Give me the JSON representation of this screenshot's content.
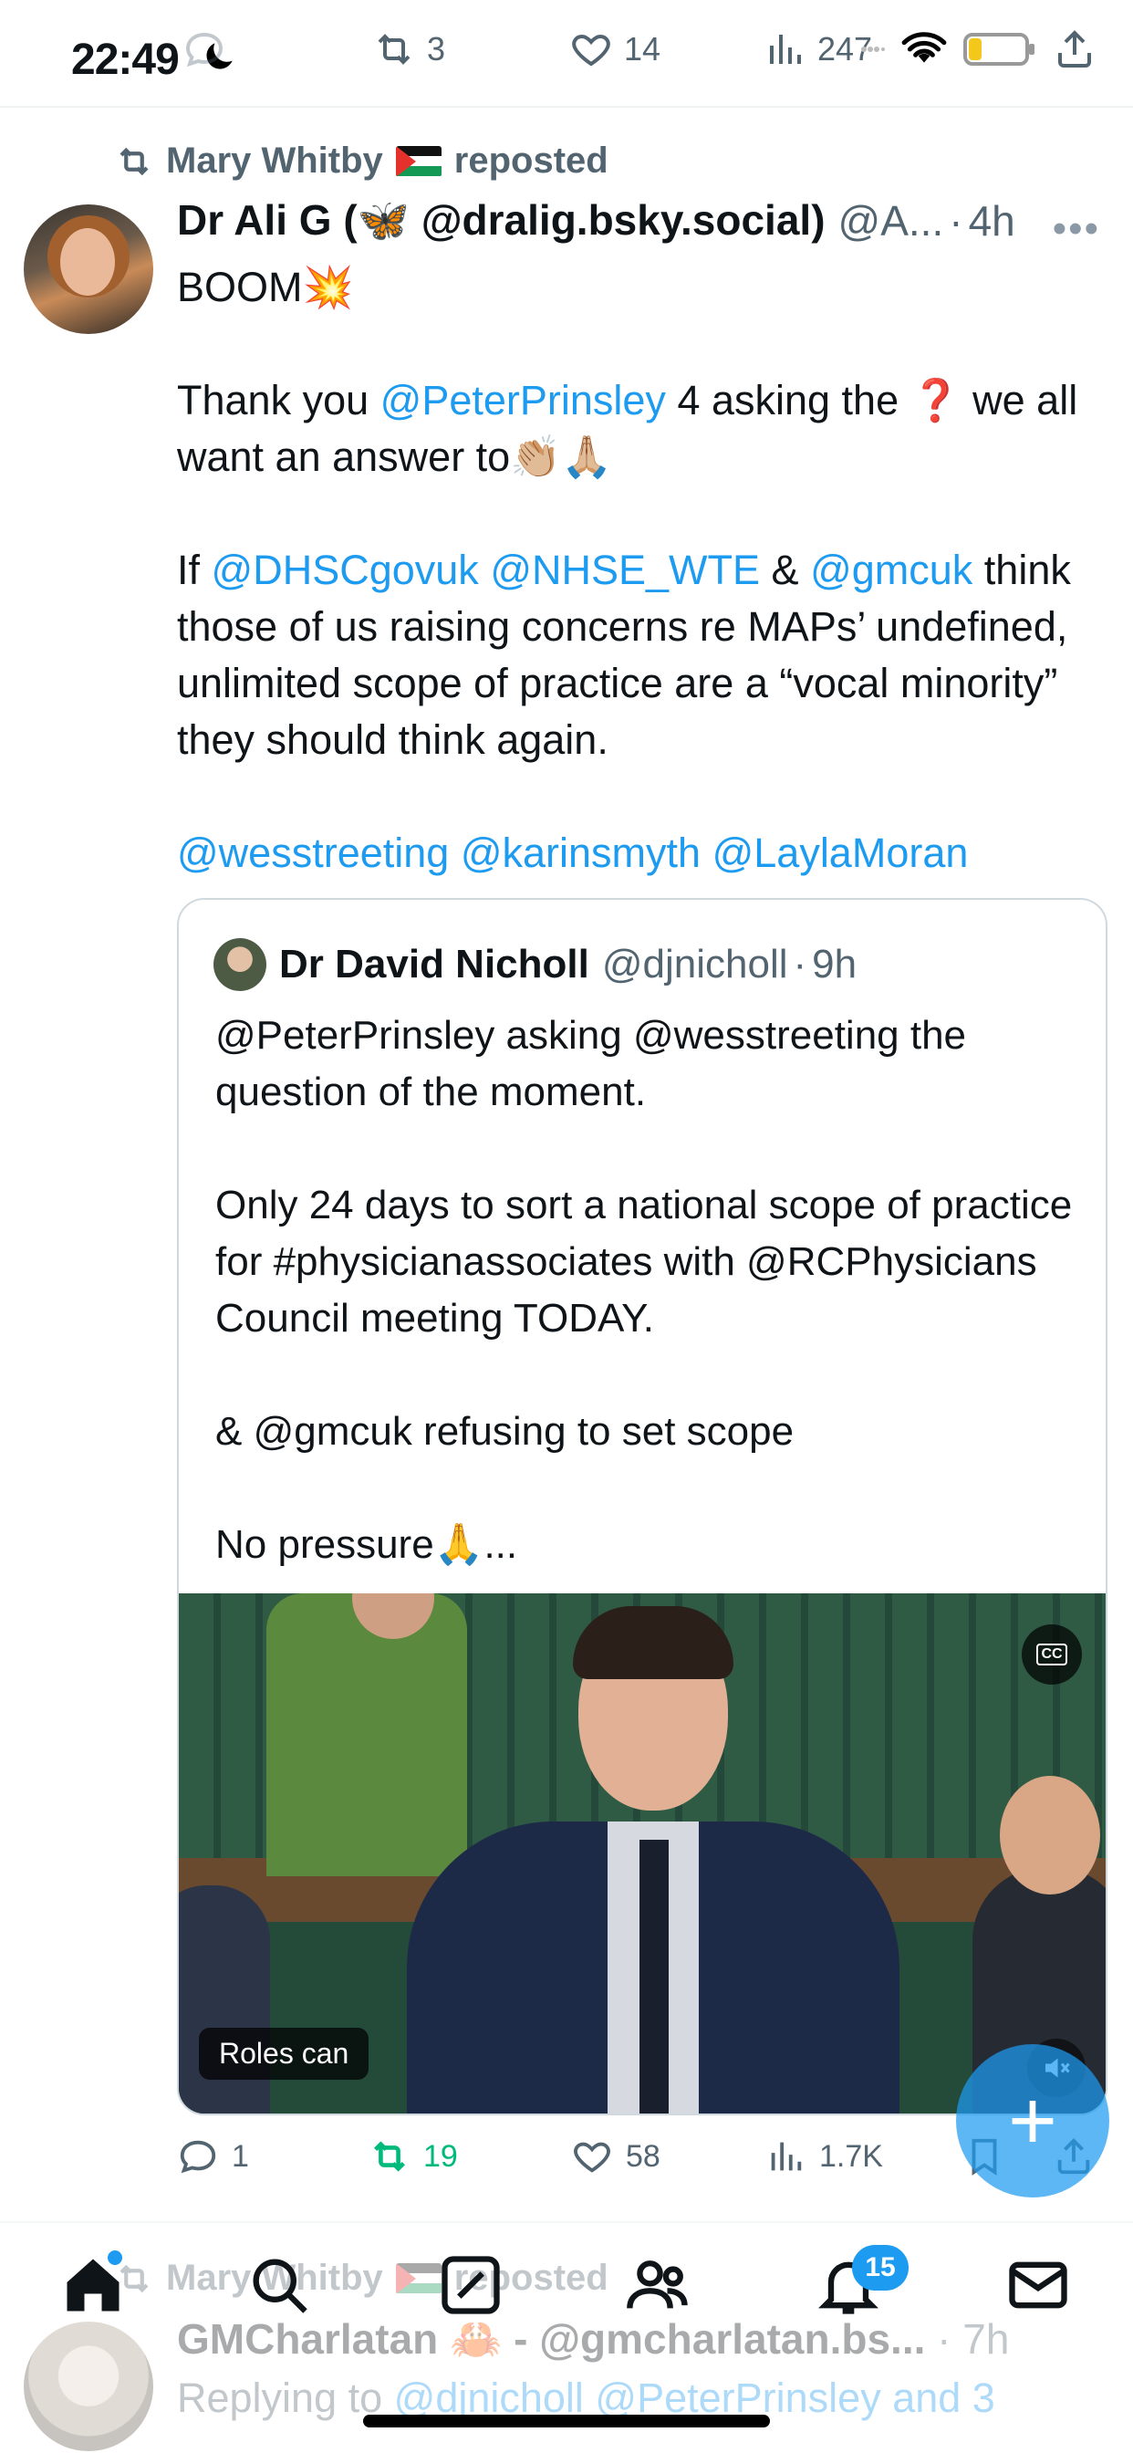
{
  "status_bar": {
    "time": "22:49",
    "reposts_count": "3",
    "likes_count": "14",
    "views_count": "247"
  },
  "tweet": {
    "reposted_by_name": "Mary Whitby",
    "reposted_label": "reposted",
    "author_name": "Dr Ali G (🦋 @dralig.bsky.social)",
    "author_handle": "@A...",
    "separator": "·",
    "timestamp": "4h",
    "line_boom": "BOOM💥",
    "p1_pre": "Thank you ",
    "p1_mention": "@PeterPrinsley",
    "p1_post": " 4 asking the ❓ we all want an answer to👏🏼🙏🏼",
    "p2_pre": "If ",
    "p2_m1": "@DHSCgovuk",
    "p2_m2": "@NHSE_WTE",
    "p2_amp": " & ",
    "p2_m3": "@gmcuk",
    "p2_post": " think those of us raising concerns re MAPs’ undefined, unlimited scope of practice are a “vocal minority” they should think again.",
    "p3_m1": "@wesstreeting",
    "p3_m2": "@karinsmyth",
    "p3_m3": "@LaylaMoran"
  },
  "quote": {
    "author_name": "Dr David Nicholl",
    "author_handle": "@djnicholl",
    "separator": "·",
    "timestamp": "9h",
    "p1": "@PeterPrinsley asking @wesstreeting the question of the moment.",
    "p2": "Only 24 days to sort a national scope of practice for #physicianassociates with @RCPhysicians Council meeting TODAY.",
    "p3": "& @gmcuk refusing to set scope",
    "p4": "No pressure🙏...",
    "video_caption": "Roles can",
    "cc_label": "CC"
  },
  "actions": {
    "replies": "1",
    "reposts": "19",
    "likes": "58",
    "views": "1.7K",
    "repost_active_color": "#00ba7c"
  },
  "next_tweet": {
    "reposted_by_name": "Mary Whitby",
    "reposted_label": "reposted",
    "author_name": "GMCharlatan 🦀 - @gmcharlatan.bs...",
    "separator": "·",
    "timestamp": "7h",
    "reply_label": "Replying to ",
    "reply_mentions": "@djnicholl @PeterPrinsley and 3"
  },
  "tabbar": {
    "notifications_badge": "15",
    "icons": [
      "home-icon",
      "search-icon",
      "compose-icon",
      "communities-icon",
      "notifications-icon",
      "messages-icon"
    ]
  },
  "colors": {
    "accent": "#1d9bf0",
    "text": "#0f1419",
    "muted": "#536471"
  }
}
